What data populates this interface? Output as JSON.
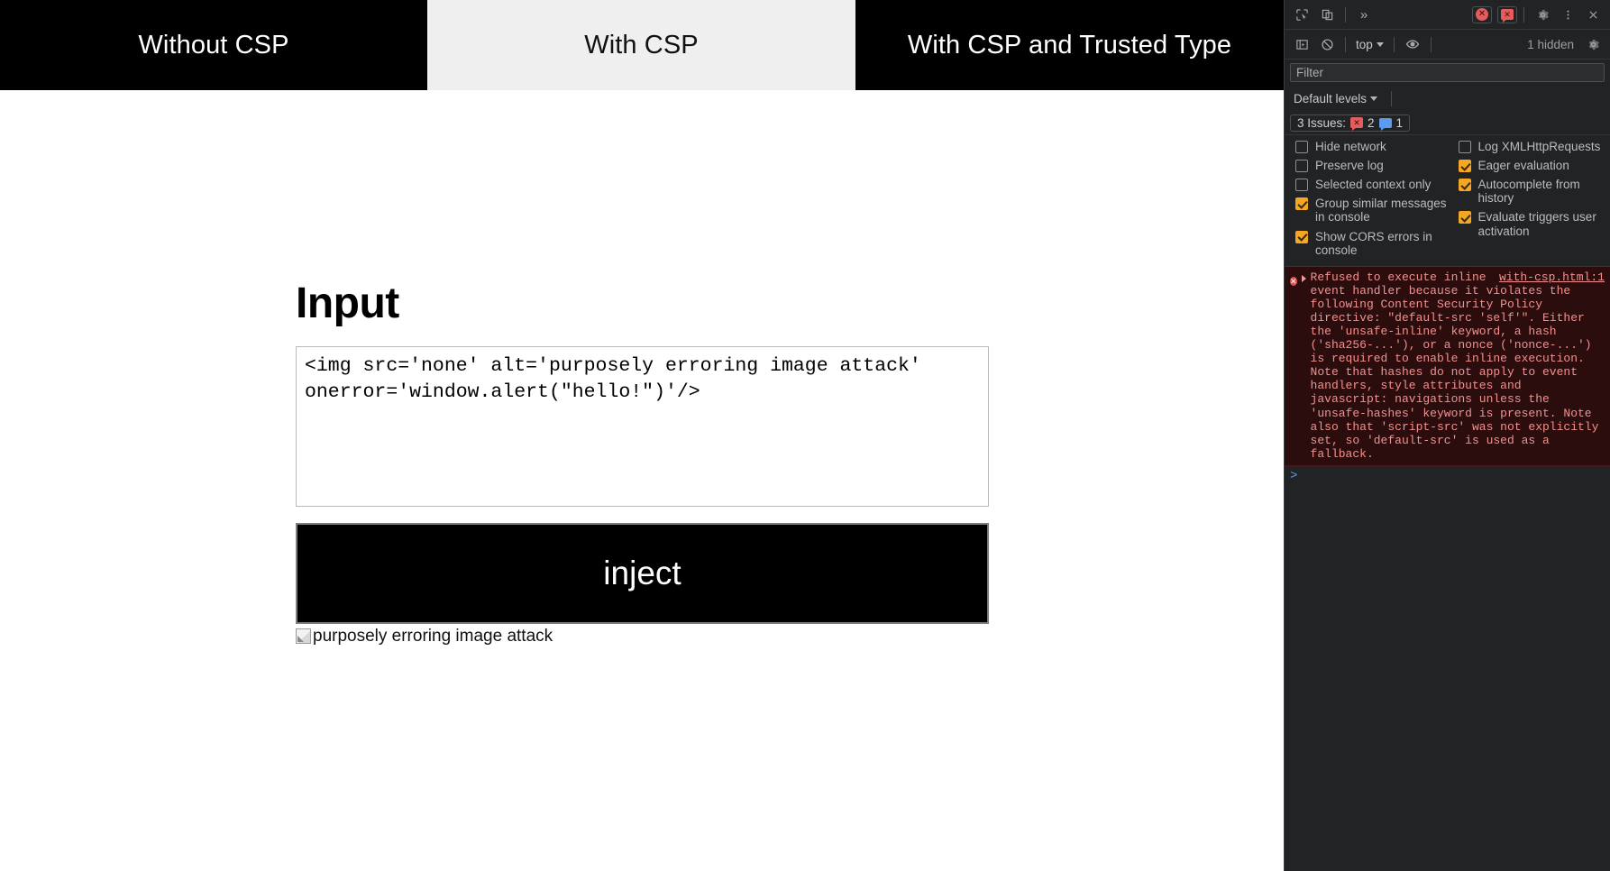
{
  "page": {
    "nav_tabs": [
      {
        "label": "Without CSP",
        "style": "dark",
        "active": false
      },
      {
        "label": "With CSP",
        "style": "light",
        "active": true
      },
      {
        "label": "With CSP and Trusted Type",
        "style": "dark",
        "active": false
      }
    ],
    "heading": "Input",
    "input_value": "<img src='none' alt='purposely erroring image attack' onerror='window.alert(\"hello!\")'/>",
    "inject_button_label": "inject",
    "output_alt_text": "purposely erroring image attack"
  },
  "devtools": {
    "toolbar_top": {
      "inspect_icon": "inspect-element-icon",
      "device_toolbar_icon": "device-toolbar-icon",
      "more_panels_label": "»",
      "error_badge_count": "",
      "issues_badge_count": "",
      "settings_icon": "gear-icon",
      "more_options_icon": "kebab-menu-icon",
      "close_icon": "close-icon"
    },
    "toolbar_console": {
      "sidebar_icon": "console-sidebar-icon",
      "clear_icon": "clear-console-icon",
      "context_label": "top",
      "eye_icon": "live-expression-icon",
      "hidden_label": "1 hidden",
      "settings_icon": "gear-icon"
    },
    "filter": {
      "placeholder": "Filter",
      "value": ""
    },
    "levels": {
      "label": "Default levels"
    },
    "issues": {
      "label": "3 Issues:",
      "error_count": "2",
      "info_count": "1"
    },
    "settings": {
      "left": [
        {
          "label": "Hide network",
          "checked": false
        },
        {
          "label": "Preserve log",
          "checked": false
        },
        {
          "label": "Selected context only",
          "checked": false
        },
        {
          "label": "Group similar messages in console",
          "checked": true
        },
        {
          "label": "Show CORS errors in console",
          "checked": true
        }
      ],
      "right": [
        {
          "label": "Log XMLHttpRequests",
          "checked": false
        },
        {
          "label": "Eager evaluation",
          "checked": true
        },
        {
          "label": "Autocomplete from history",
          "checked": true
        },
        {
          "label": "Evaluate triggers user activation",
          "checked": true
        }
      ]
    },
    "console_messages": [
      {
        "level": "error",
        "source": "with-csp.html:1",
        "text": "Refused to execute inline event handler because it violates the following Content Security Policy directive: \"default-src 'self'\". Either the 'unsafe-inline' keyword, a hash ('sha256-...'), or a nonce ('nonce-...') is required to enable inline execution. Note that hashes do not apply to event handlers, style attributes and javascript: navigations unless the 'unsafe-hashes' keyword is present. Note also that 'script-src' was not explicitly set, so 'default-src' is used as a fallback."
      }
    ],
    "prompt": {
      "chevron": ">",
      "value": ""
    },
    "colors": {
      "error_text": "#f2918f",
      "error_bg": "#2c0d0d",
      "checkbox_checked": "#f5a623",
      "prompt_chevron": "#5a9bf0",
      "panel_bg": "#222324"
    }
  }
}
